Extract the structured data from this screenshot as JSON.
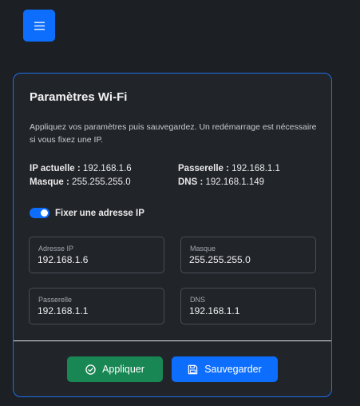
{
  "header": {
    "menu_icon": "hamburger-icon"
  },
  "card": {
    "title": "Paramètres Wi-Fi",
    "help_text": "Appliquez vos paramètres puis sauvegardez. Un redémarrage est nécessaire si vous fixez une IP.",
    "current": {
      "ip_label": "IP actuelle :",
      "ip_value": "192.168.1.6",
      "gateway_label": "Passerelle :",
      "gateway_value": "192.168.1.1",
      "mask_label": "Masque :",
      "mask_value": "255.255.255.0",
      "dns_label": "DNS :",
      "dns_value": "192.168.1.149"
    },
    "static_ip": {
      "label": "Fixer une adresse IP",
      "enabled": true
    },
    "fields": {
      "ip": {
        "label": "Adresse IP",
        "value": "192.168.1.6"
      },
      "mask": {
        "label": "Masque",
        "value": "255.255.255.0"
      },
      "gateway": {
        "label": "Passerelle",
        "value": "192.168.1.1"
      },
      "dns": {
        "label": "DNS",
        "value": "192.168.1.1"
      }
    },
    "buttons": {
      "apply_label": "Appliquer",
      "apply_icon": "check-circle-icon",
      "save_label": "Sauvegarder",
      "save_icon": "floppy-disk-icon"
    }
  },
  "colors": {
    "primary": "#0d6efd",
    "success": "#198754",
    "background": "#1c1f23",
    "card_border": "#1f6feb"
  }
}
